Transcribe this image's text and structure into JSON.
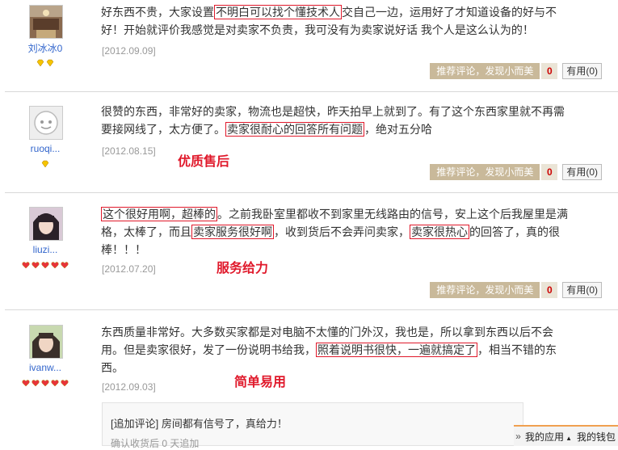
{
  "reviews": [
    {
      "username": "刘冰冰0",
      "badge_count": 2,
      "badge_type": "diamond",
      "text_parts": [
        {
          "t": "好东西不贵，大家设置",
          "hl": false
        },
        {
          "t": "不明白可以找个懂技术人",
          "hl": true
        },
        {
          "t": "交自己一边，运用好了才知道设备的好与不好！开始就评价我感觉是对卖家不负责，我可没有为卖家说好话 我个人是这么认为的！",
          "hl": false
        }
      ],
      "date": "[2012.09.09]",
      "annotation": ""
    },
    {
      "username": "ruoqi...",
      "badge_count": 1,
      "badge_type": "diamond",
      "text_parts": [
        {
          "t": "很赞的东西，非常好的卖家，物流也是超快，昨天拍早上就到了。有了这个东西家里就不再需要接网线了，太方便了。",
          "hl": false
        },
        {
          "t": "卖家很耐心的回答所有问题",
          "hl": true
        },
        {
          "t": "，绝对五分哈",
          "hl": false
        }
      ],
      "date": "[2012.08.15]",
      "annotation": "优质售后"
    },
    {
      "username": "liuzi...",
      "badge_count": 5,
      "badge_type": "heart",
      "text_parts": [
        {
          "t": "这个很好用啊，超棒的",
          "hl": true
        },
        {
          "t": "。之前我卧室里都收不到家里无线路由的信号，安上这个后我屋里是满格，太棒了，而且",
          "hl": false
        },
        {
          "t": "卖家服务很好啊",
          "hl": true
        },
        {
          "t": "，收到货后不会弄问卖家，",
          "hl": false
        },
        {
          "t": "卖家很热心",
          "hl": true
        },
        {
          "t": "的回答了，真的很棒！！！",
          "hl": false
        }
      ],
      "date": "[2012.07.20]",
      "annotation": "服务给力"
    },
    {
      "username": "ivanw...",
      "badge_count": 5,
      "badge_type": "heart",
      "text_parts": [
        {
          "t": "东西质量非常好。大多数买家都是对电脑不太懂的门外汉，我也是，所以拿到东西以后不会用。但是卖家很好，发了一份说明书给我，",
          "hl": false
        },
        {
          "t": "照着说明书很快，一遍就搞定了",
          "hl": true
        },
        {
          "t": "，相当不错的东西。",
          "hl": false
        }
      ],
      "date": "[2012.09.03]",
      "annotation": "简单易用"
    }
  ],
  "actions": {
    "recommend_label": "推荐评论，发现小而美",
    "recommend_count": "0",
    "useful_label": "有用(0)"
  },
  "append": {
    "text": "[追加评论] 房间都有信号了，真给力！",
    "sub": "确认收货后 0 天追加"
  },
  "bottom_bar": {
    "arrows": "»",
    "my_apps": "我的应用",
    "my_wallet": "我的钱包"
  },
  "colors": {
    "highlight_border": "#e0192b",
    "annotation": "#e0192b",
    "recommend_bg": "#c9b99a",
    "username": "#3366cc"
  }
}
